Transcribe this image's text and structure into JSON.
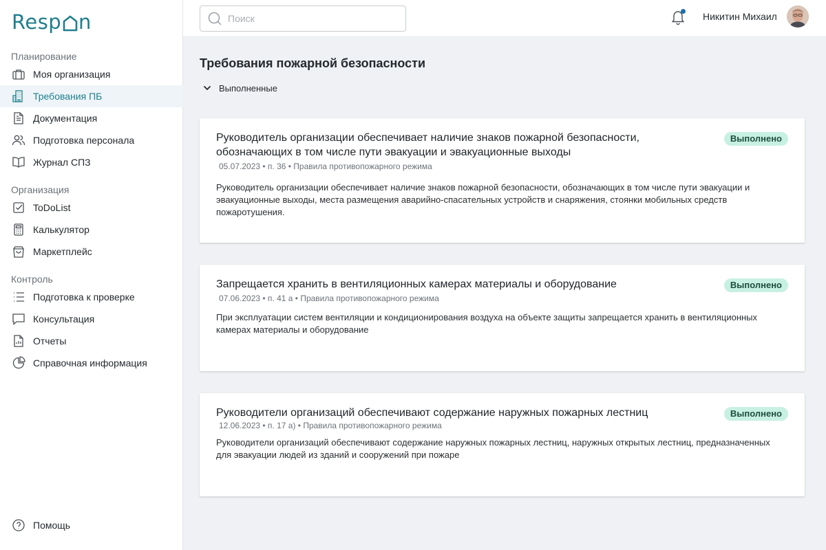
{
  "brand": {
    "logo_text": "Respon",
    "accent": "#1f7f8c"
  },
  "sidebar": {
    "sections": [
      {
        "title": "Планирование",
        "items": [
          {
            "label": "Моя организация",
            "icon": "briefcase-icon"
          },
          {
            "label": "Требования ПБ",
            "icon": "building-icon",
            "active": true
          },
          {
            "label": "Документация",
            "icon": "document-icon"
          },
          {
            "label": "Подготовка персонала",
            "icon": "users-icon"
          },
          {
            "label": "Журнал СПЗ",
            "icon": "book-icon"
          }
        ]
      },
      {
        "title": "Организация",
        "items": [
          {
            "label": "ToDoList",
            "icon": "checklist-icon"
          },
          {
            "label": "Калькулятор",
            "icon": "calculator-icon"
          },
          {
            "label": "Маркетплейс",
            "icon": "shopping-bag-icon"
          }
        ]
      },
      {
        "title": "Контроль",
        "items": [
          {
            "label": "Подготовка к проверке",
            "icon": "list-icon"
          },
          {
            "label": "Консультация",
            "icon": "chat-icon"
          },
          {
            "label": "Отчеты",
            "icon": "report-icon"
          },
          {
            "label": "Справочная информация",
            "icon": "pie-chart-icon"
          }
        ]
      }
    ],
    "help_label": "Помощь"
  },
  "topbar": {
    "search_placeholder": "Поиск",
    "user_name": "Никитин Михаил",
    "notification_dot_color": "#1b6fae"
  },
  "main": {
    "title": "Требования пожарной безопасности",
    "filter_label": "Выполненные",
    "cards": [
      {
        "title": "Руководитель организации обеспечивает наличие знаков пожарной безопасности, обозначающих в том числе пути эвакуации и эвакуационные выходы",
        "status": "Выполнено",
        "meta": "05.07.2023 • п. 36 • Правила противопожарного режима",
        "description": "Руководитель организации обеспечивает наличие знаков пожарной безопасности, обозначающих в том числе пути эвакуации и эвакуационные выходы, места размещения аварийно-спасательных устройств и снаряжения, стоянки мобильных средств пожаротушения."
      },
      {
        "title": "Запрещается хранить в вентиляционных камерах материалы и оборудование",
        "status": "Выполнено",
        "meta": "07.06.2023 • п. 41 а • Правила противопожарного режима",
        "description": "При эксплуатации систем вентиляции и кондиционирования воздуха на объекте защиты запрещается хранить в вентиляционных камерах материалы и оборудование"
      },
      {
        "title": "Руководители организаций обеспечивают содержание наружных пожарных лестниц",
        "status": "Выполнено",
        "meta": "12.06.2023 • п. 17 а) • Правила противопожарного режима",
        "description": "Руководители организаций обеспечивают содержание наружных пожарных лестниц, наружных открытых лестниц, предназначенных для эвакуации людей из зданий и сооружений при пожаре"
      }
    ]
  },
  "colors": {
    "status_badge_bg": "#c7f0e3",
    "status_badge_text": "#1e4d3c",
    "active_nav_bg": "#eef4f8"
  }
}
